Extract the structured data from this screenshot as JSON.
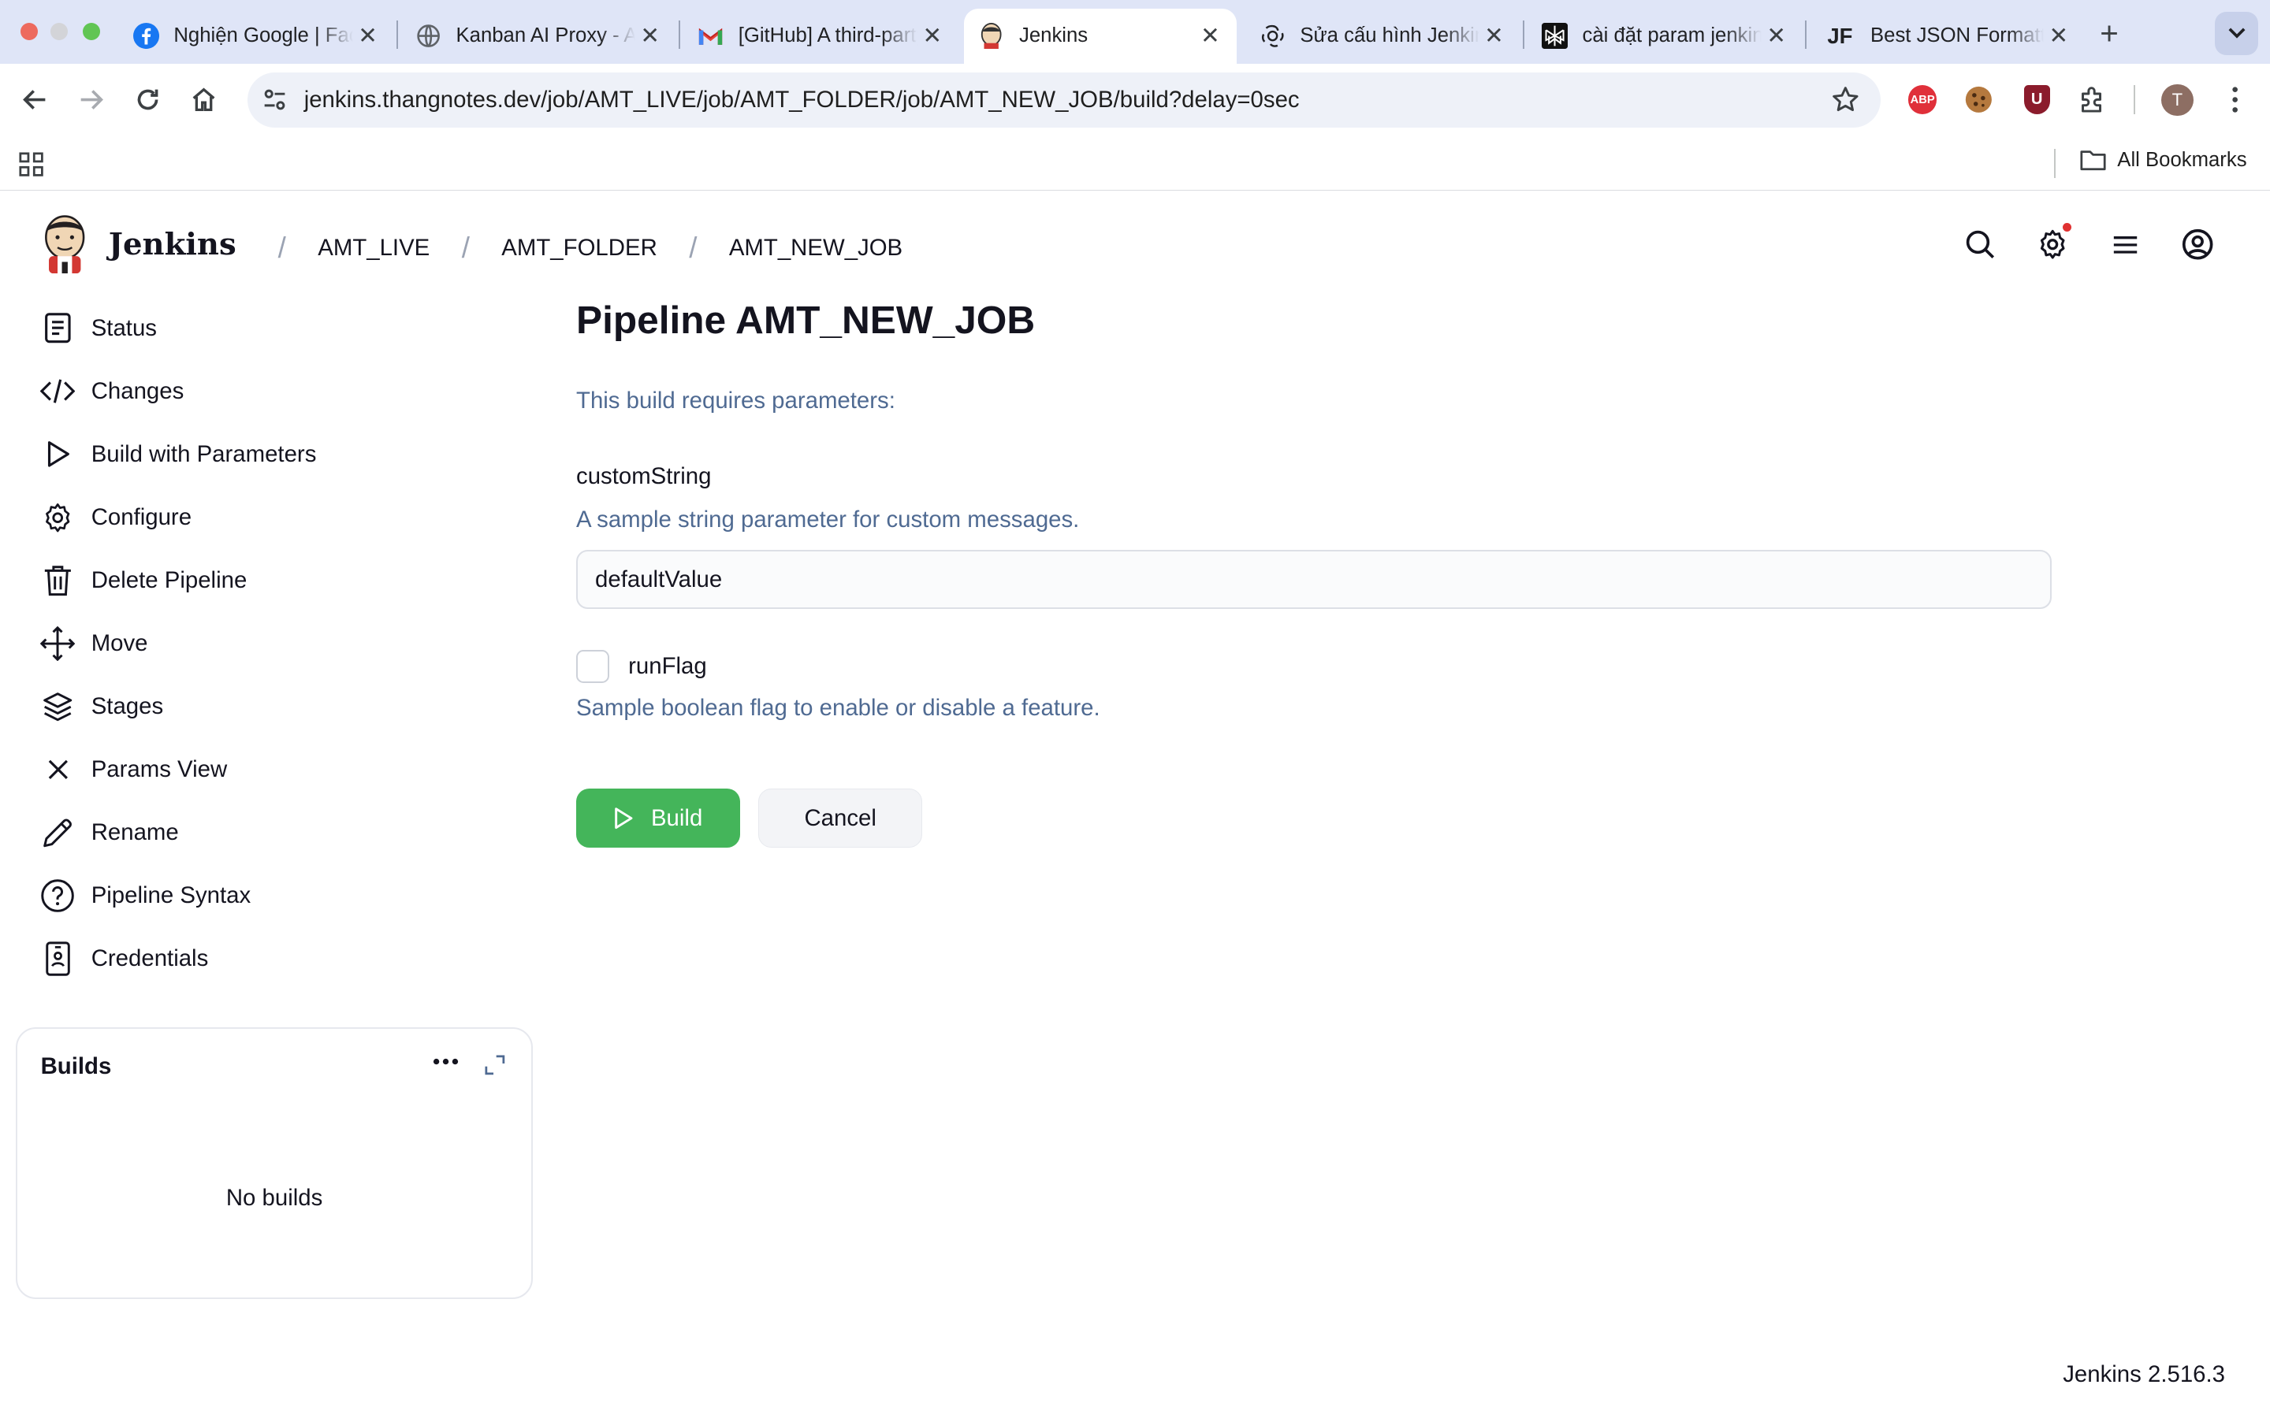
{
  "browser": {
    "tabs": [
      {
        "title": "Nghiện Google | Facebook",
        "icon": "facebook-icon",
        "active": false
      },
      {
        "title": "Kanban AI Proxy - Admin",
        "icon": "globe-icon",
        "active": false
      },
      {
        "title": "[GitHub] A third-party OAuth",
        "icon": "gmail-icon",
        "active": false
      },
      {
        "title": "Jenkins",
        "icon": "jenkins-icon",
        "active": true
      },
      {
        "title": "Sửa cấu hình Jenkins",
        "icon": "chatgpt-icon",
        "active": false
      },
      {
        "title": "cài đặt param jenkins",
        "icon": "perplexity-icon",
        "active": false
      },
      {
        "title": "Best JSON Formatter",
        "icon": "jf-icon",
        "active": false
      }
    ],
    "url": "jenkins.thangnotes.dev/job/AMT_LIVE/job/AMT_FOLDER/job/AMT_NEW_JOB/build?delay=0sec",
    "profile_initial": "T",
    "abp_label": "ABP",
    "ublock_label": "U",
    "jf_label": "JF",
    "all_bookmarks": "All Bookmarks"
  },
  "jenkins": {
    "brand": "Jenkins",
    "breadcrumbs": [
      "AMT_LIVE",
      "AMT_FOLDER",
      "AMT_NEW_JOB"
    ],
    "sidebar": [
      {
        "label": "Status",
        "icon": "status-icon"
      },
      {
        "label": "Changes",
        "icon": "code-icon"
      },
      {
        "label": "Build with Parameters",
        "icon": "play-icon"
      },
      {
        "label": "Configure",
        "icon": "gear-icon"
      },
      {
        "label": "Delete Pipeline",
        "icon": "trash-icon"
      },
      {
        "label": "Move",
        "icon": "move-icon"
      },
      {
        "label": "Stages",
        "icon": "layers-icon"
      },
      {
        "label": "Params View",
        "icon": "close-icon"
      },
      {
        "label": "Rename",
        "icon": "pencil-icon"
      },
      {
        "label": "Pipeline Syntax",
        "icon": "help-icon"
      },
      {
        "label": "Credentials",
        "icon": "credentials-icon"
      }
    ],
    "builds": {
      "title": "Builds",
      "empty": "No builds"
    },
    "page": {
      "title": "Pipeline AMT_NEW_JOB",
      "hint": "This build requires parameters:",
      "params": {
        "string": {
          "name": "customString",
          "description": "A sample string parameter for custom messages.",
          "value": "defaultValue"
        },
        "bool": {
          "name": "runFlag",
          "description": "Sample boolean flag to enable or disable a feature.",
          "checked": false
        }
      },
      "build_label": "Build",
      "cancel_label": "Cancel"
    },
    "version": "Jenkins 2.516.3",
    "colors": {
      "build_button": "#44b55a",
      "description_text": "#4f6a92"
    }
  }
}
